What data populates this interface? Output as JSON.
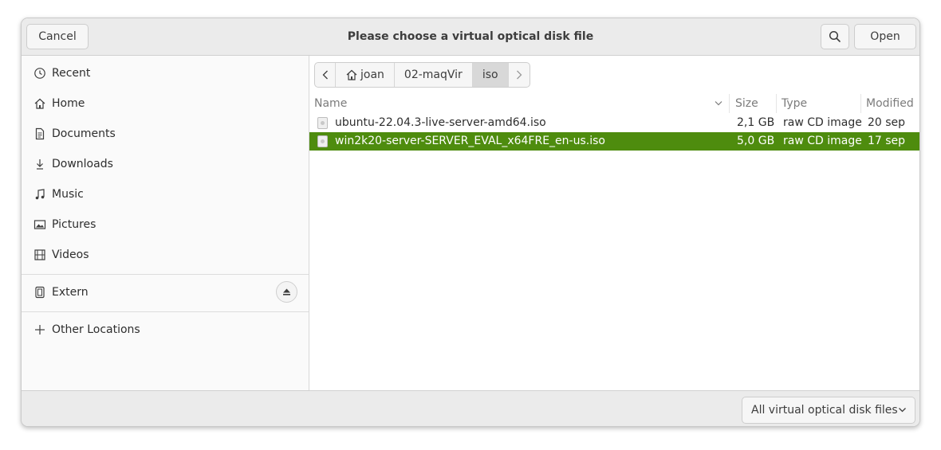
{
  "dialog": {
    "title": "Please choose a virtual optical disk file",
    "cancel_label": "Cancel",
    "open_label": "Open"
  },
  "sidebar": {
    "items": [
      {
        "label": "Recent",
        "icon": "clock-icon"
      },
      {
        "label": "Home",
        "icon": "home-icon"
      },
      {
        "label": "Documents",
        "icon": "document-icon"
      },
      {
        "label": "Downloads",
        "icon": "download-icon"
      },
      {
        "label": "Music",
        "icon": "music-icon"
      },
      {
        "label": "Pictures",
        "icon": "picture-icon"
      },
      {
        "label": "Videos",
        "icon": "film-icon"
      }
    ],
    "device": {
      "label": "Extern",
      "icon": "drive-icon"
    },
    "other": {
      "label": "Other Locations",
      "icon": "plus-icon"
    }
  },
  "pathbar": {
    "crumbs": [
      "joan",
      "02-maqVir",
      "iso"
    ]
  },
  "table": {
    "columns": [
      "Name",
      "Size",
      "Type",
      "Modified"
    ],
    "rows": [
      {
        "name": "ubuntu-22.04.3-live-server-amd64.iso",
        "size": "2,1 GB",
        "type": "raw CD image",
        "modified": "20 sep",
        "selected": false
      },
      {
        "name": "win2k20-server-SERVER_EVAL_x64FRE_en-us.iso",
        "size": "5,0 GB",
        "type": "raw CD image",
        "modified": "17 sep",
        "selected": true
      }
    ]
  },
  "footer": {
    "filter_label": "All virtual optical disk files"
  },
  "colors": {
    "selection": "#4e8c0e"
  }
}
